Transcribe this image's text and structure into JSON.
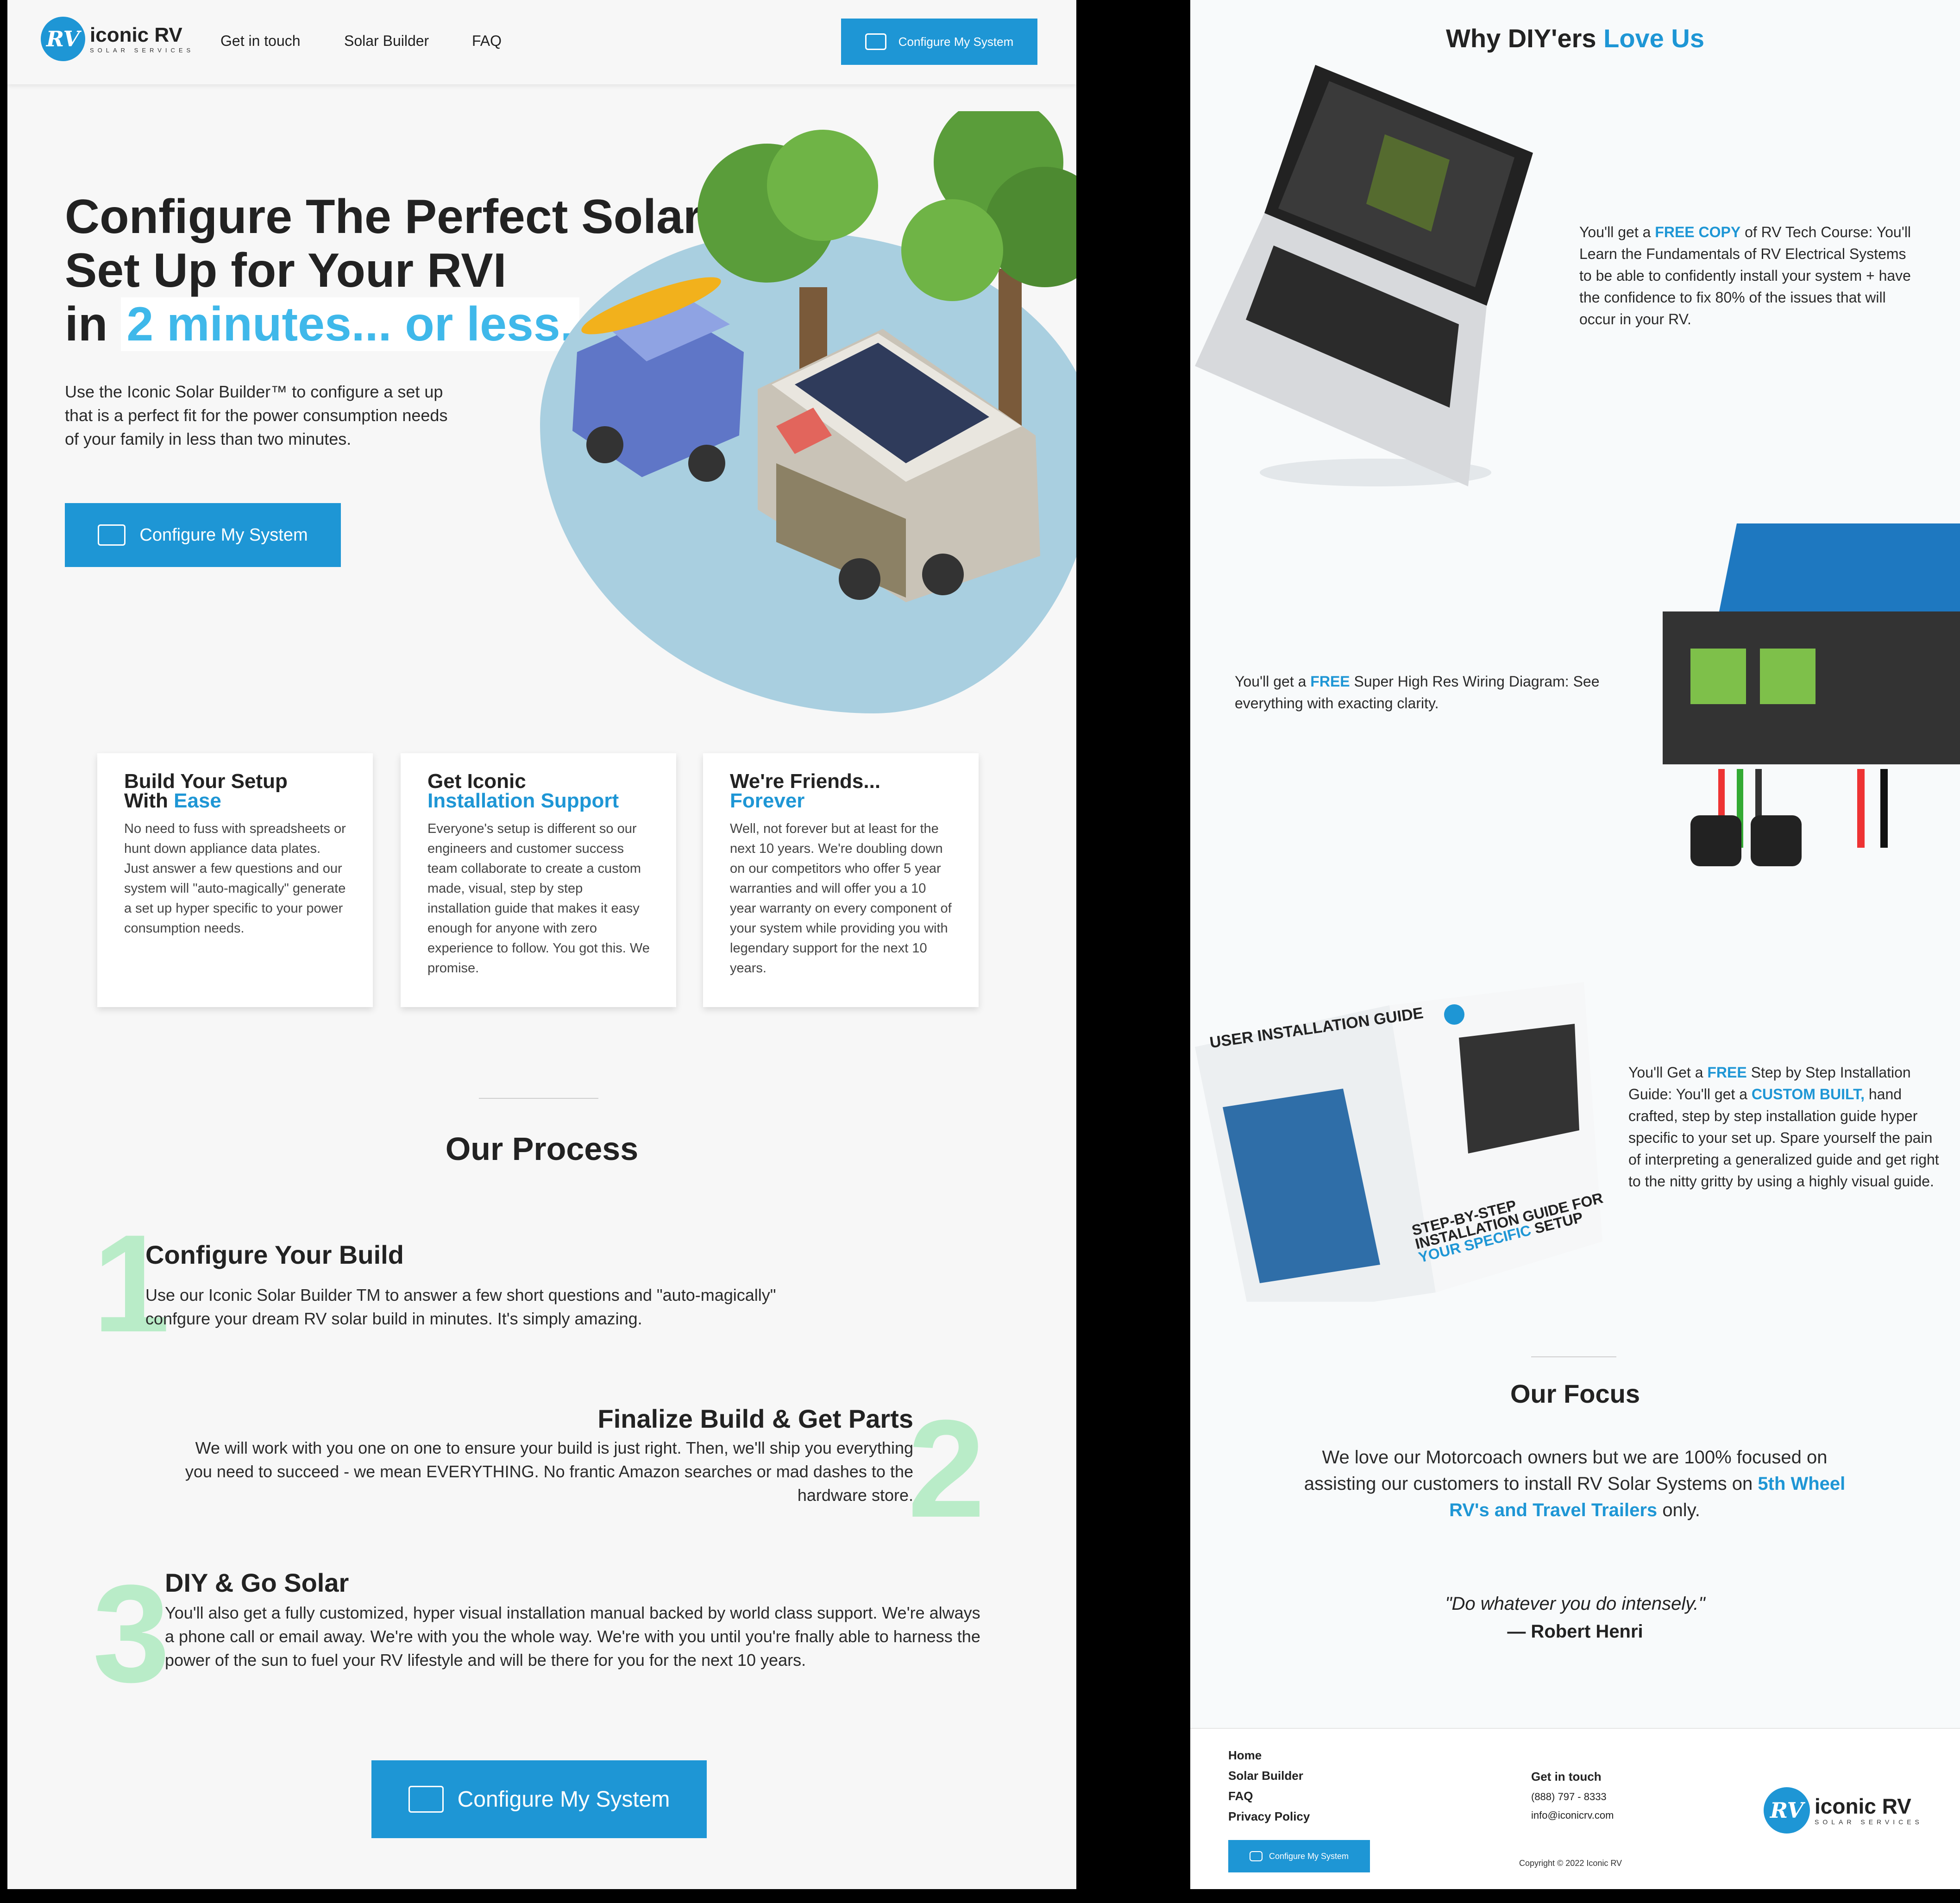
{
  "header": {
    "brand": "iconic RV",
    "brand_sub": "SOLAR SERVICES",
    "nav": [
      "Get in touch",
      "Solar Builder",
      "FAQ"
    ],
    "cta": "Configure My System"
  },
  "hero": {
    "title_line1": "Configure The Perfect Solar",
    "title_line2": "Set Up for Your RVI",
    "title_in": "in",
    "title_highlight": "2 minutes... or less.",
    "lede": "Use the Iconic Solar Builder™ to configure a set up that is a perfect fit for the power consumption needs of your family in less than two minutes.",
    "cta": "Configure My System"
  },
  "cards": [
    {
      "title_a": "Build Your Setup",
      "title_b": "With",
      "title_accent": "Ease",
      "body": "No need to fuss with spreadsheets or hunt down appliance data plates. Just answer a few questions and our system will \"auto-magically\" generate a set up hyper specific to your power consumption needs."
    },
    {
      "title_a": "Get Iconic",
      "title_b": "",
      "title_accent": "Installation Support",
      "body": "Everyone's setup is different so our engineers and customer success team collaborate to create a custom made, visual, step by step installation guide that makes it easy enough for anyone with zero experience to follow. You got this. We promise."
    },
    {
      "title_a": "We're Friends...",
      "title_b": "",
      "title_accent": "Forever",
      "body": "Well, not forever but at least for the next 10 years. We're doubling down on our competitors who offer 5 year warranties and will offer you a 10 year warranty on every component of your system while providing you with legendary support for the next 10 years."
    }
  ],
  "process": {
    "title": "Our Process",
    "steps": [
      {
        "num": "1",
        "title": "Configure Your Build",
        "body": "Use our Iconic Solar Builder TM to answer a few short questions and \"auto-magically\" confgure your dream RV solar build in minutes. It's simply amazing."
      },
      {
        "num": "2",
        "title": "Finalize Build & Get Parts",
        "body": "We will work with you one on one to ensure your build is just right. Then, we'll ship you everything you need to succeed - we mean EVERYTHING. No frantic Amazon searches or mad dashes to the hardware store."
      },
      {
        "num": "3",
        "title": "DIY & Go Solar",
        "body": "You'll also get a fully customized, hyper visual installation manual backed by world class support. We're always a phone call or email away. We're with you the whole way. We're with you until you're fnally able to harness the power of the sun to fuel your RV lifestyle and will be there for you for the next 10 years."
      }
    ],
    "cta": "Configure My System"
  },
  "why": {
    "title_a": "Why DIY'ers",
    "title_b": "Love Us",
    "item1_pre": "You'll get a",
    "item1_accent": "FREE COPY",
    "item1_post": "of RV Tech Course: You'll Learn the Fundamentals of RV Electrical Systems to be able to confidently install your system + have the confidence to fix 80% of the issues that will occur in your RV.",
    "item2_pre": "You'll get a",
    "item2_accent": "FREE",
    "item2_post": "Super High Res Wiring Diagram: See everything with exacting clarity.",
    "item3_pre": "You'll Get a",
    "item3_accent": "FREE",
    "item3_mid": "Step by Step Installation Guide: You'll get a",
    "item3_accent2": "CUSTOM BUILT,",
    "item3_post": "hand crafted, step by step installation guide hyper specific to your set up. Spare yourself the pain of interpreting a generalized guide and get right to the nitty gritty by using a highly visual guide.",
    "book_title": "USER INSTALLATION GUIDE",
    "book_sub1": "STEP-BY-STEP INSTALLATION GUIDE FOR",
    "book_sub2": "YOUR SPECIFIC",
    "book_sub3": "SETUP"
  },
  "focus": {
    "title": "Our Focus",
    "body": "We love our Motorcoach owners but we are 100% focused on assisting our customers to install RV Solar Systems on",
    "accent": "5th Wheel RV's and Travel Trailers",
    "tail": "only.",
    "quote": "\"Do whatever you do intensely.\"",
    "author": "— Robert Henri"
  },
  "footer": {
    "links": [
      "Home",
      "Solar Builder",
      "FAQ",
      "Privacy Policy"
    ],
    "cta": "Configure My System",
    "contact_title": "Get in touch",
    "phone": "(888) 797 - 8333",
    "email": "info@iconicrv.com",
    "copyright": "Copyright © 2022 Iconic RV"
  },
  "colors": {
    "accent": "#1e96d5",
    "highlight": "#3fb8ea",
    "step_number": "#b9ecc8"
  }
}
